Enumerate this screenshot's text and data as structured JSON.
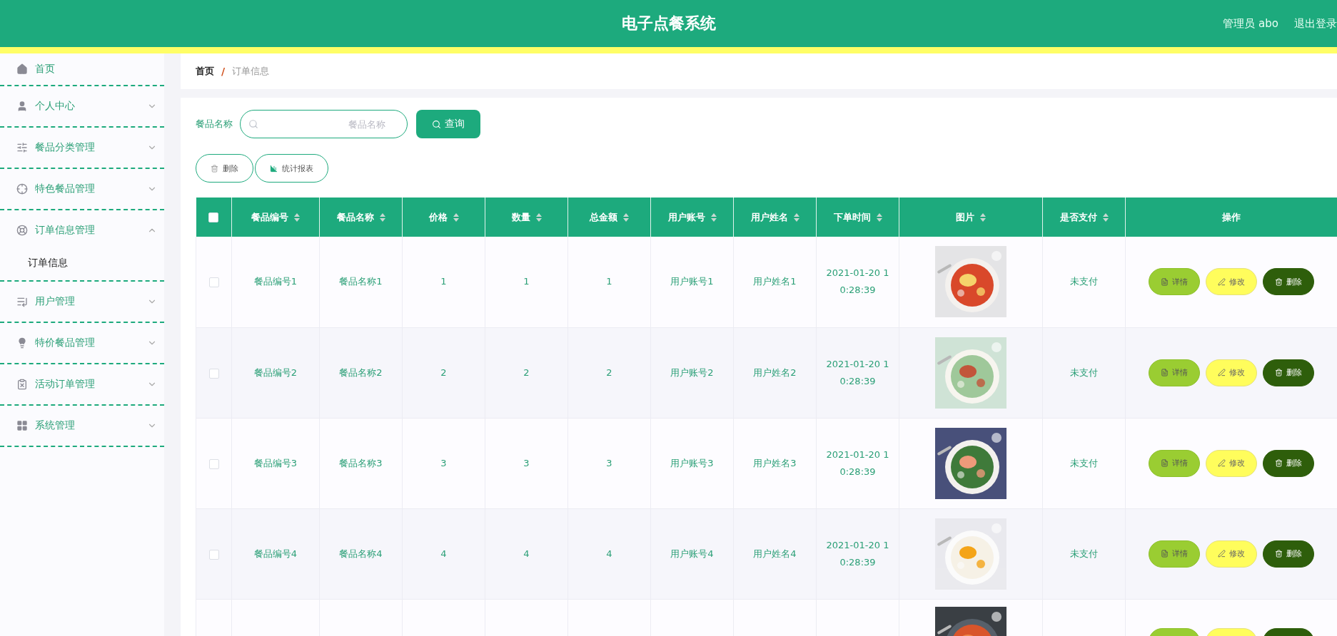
{
  "header": {
    "title": "电子点餐系统",
    "user": "管理员 abo",
    "logout": "退出登录"
  },
  "sidebar": {
    "items": [
      {
        "kind": "link",
        "label": "首页"
      },
      {
        "kind": "menu",
        "label": "个人中心",
        "expanded": false
      },
      {
        "kind": "menu",
        "label": "餐品分类管理",
        "expanded": false
      },
      {
        "kind": "menu",
        "label": "特色餐品管理",
        "expanded": false
      },
      {
        "kind": "menu",
        "label": "订单信息管理",
        "expanded": true,
        "children": [
          {
            "label": "订单信息"
          }
        ]
      },
      {
        "kind": "menu",
        "label": "用户管理",
        "expanded": false
      },
      {
        "kind": "menu",
        "label": "特价餐品管理",
        "expanded": false
      },
      {
        "kind": "menu",
        "label": "活动订单管理",
        "expanded": false
      },
      {
        "kind": "menu",
        "label": "系统管理",
        "expanded": false
      }
    ]
  },
  "breadcrumb": {
    "items": [
      "首页",
      "订单信息"
    ],
    "separator": "/"
  },
  "search": {
    "label": "餐品名称",
    "placeholder": "餐品名称",
    "button": "查询"
  },
  "actions": [
    "删除",
    "统计报表"
  ],
  "table": {
    "select_all": {
      "checked": false
    },
    "columns": [
      {
        "label": "餐品编号",
        "sortable": true
      },
      {
        "label": "餐品名称",
        "sortable": true
      },
      {
        "label": "价格",
        "sortable": true
      },
      {
        "label": "数量",
        "sortable": true
      },
      {
        "label": "总金额",
        "sortable": true
      },
      {
        "label": "用户账号",
        "sortable": true
      },
      {
        "label": "用户姓名",
        "sortable": true
      },
      {
        "label": "下单时间",
        "sortable": true
      },
      {
        "label": "图片",
        "sortable": true
      },
      {
        "label": "是否支付",
        "sortable": true
      },
      {
        "label": "操作",
        "sortable": false
      }
    ],
    "rows": [
      {
        "kind": "full",
        "checked": false,
        "cells": [
          "餐品编号1",
          "餐品名称1",
          "1",
          "1",
          "1",
          "用户账号1",
          "用户姓名1",
          "2021-01-20 10:28:39"
        ],
        "picture": {
          "kind": "picture"
        },
        "paid": "未支付",
        "actions": [
          "详情",
          "修改",
          "删除"
        ]
      },
      {
        "kind": "full",
        "checked": false,
        "cells": [
          "餐品编号2",
          "餐品名称2",
          "2",
          "2",
          "2",
          "用户账号2",
          "用户姓名2",
          "2021-01-20 10:28:39"
        ],
        "picture": {
          "kind": "picture"
        },
        "paid": "未支付",
        "actions": [
          "详情",
          "修改",
          "删除"
        ]
      },
      {
        "kind": "full",
        "checked": false,
        "cells": [
          "餐品编号3",
          "餐品名称3",
          "3",
          "3",
          "3",
          "用户账号3",
          "用户姓名3",
          "2021-01-20 10:28:39"
        ],
        "picture": {
          "kind": "picture"
        },
        "paid": "未支付",
        "actions": [
          "详情",
          "修改",
          "删除"
        ]
      },
      {
        "kind": "full",
        "checked": false,
        "cells": [
          "餐品编号4",
          "餐品名称4",
          "4",
          "4",
          "4",
          "用户账号4",
          "用户姓名4",
          "2021-01-20 10:28:39"
        ],
        "picture": {
          "kind": "picture"
        },
        "paid": "未支付",
        "actions": [
          "详情",
          "修改",
          "删除"
        ]
      },
      {
        "kind": "partial",
        "picture": {
          "kind": "picture"
        }
      }
    ]
  }
}
